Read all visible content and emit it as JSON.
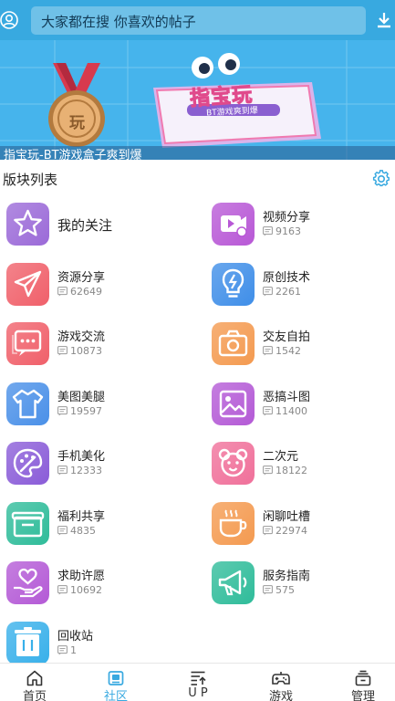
{
  "search": {
    "placeholder": "大家都在搜  你喜欢的帖子"
  },
  "banner": {
    "caption": "指宝玩-BT游戏盒子爽到爆",
    "logo_text": "指宝玩",
    "tagline": "BT游戏爽到爆",
    "medal_text": "玩"
  },
  "section": {
    "title": "版块列表"
  },
  "boards": [
    {
      "name": "我的关注",
      "count": "",
      "icon": "star-icon",
      "color": "#9b6ad8"
    },
    {
      "name": "视频分享",
      "count": "9163",
      "icon": "video-icon",
      "color": "#b858d6"
    },
    {
      "name": "资源分享",
      "count": "62649",
      "icon": "paper-plane-icon",
      "color": "#f0606a"
    },
    {
      "name": "原创技术",
      "count": "2261",
      "icon": "lightbulb-icon",
      "color": "#3f8ee8"
    },
    {
      "name": "游戏交流",
      "count": "10873",
      "icon": "chat-icon",
      "color": "#f0606a"
    },
    {
      "name": "交友自拍",
      "count": "1542",
      "icon": "camera-icon",
      "color": "#f49a50"
    },
    {
      "name": "美图美腿",
      "count": "19597",
      "icon": "tshirt-icon",
      "color": "#4a90e8"
    },
    {
      "name": "恶搞斗图",
      "count": "11400",
      "icon": "image-icon",
      "color": "#b45ad6"
    },
    {
      "name": "手机美化",
      "count": "12333",
      "icon": "palette-icon",
      "color": "#8a5cd8"
    },
    {
      "name": "二次元",
      "count": "18122",
      "icon": "bear-icon",
      "color": "#f0709a"
    },
    {
      "name": "福利共享",
      "count": "4835",
      "icon": "gift-icon",
      "color": "#2fbc9a"
    },
    {
      "name": "闲聊吐槽",
      "count": "22974",
      "icon": "coffee-icon",
      "color": "#f49a50"
    },
    {
      "name": "求助许愿",
      "count": "10692",
      "icon": "heart-hand-icon",
      "color": "#b45ad6"
    },
    {
      "name": "服务指南",
      "count": "575",
      "icon": "megaphone-icon",
      "color": "#2fbc9a"
    },
    {
      "name": "回收站",
      "count": "1",
      "icon": "trash-icon",
      "color": "#38b0ea"
    }
  ],
  "tabs": [
    {
      "label": "首页",
      "icon": "home-icon"
    },
    {
      "label": "社区",
      "icon": "community-icon",
      "active": true
    },
    {
      "label": "U P",
      "icon": "up-icon"
    },
    {
      "label": "游戏",
      "icon": "gamepad-icon"
    },
    {
      "label": "管理",
      "icon": "manage-icon"
    }
  ],
  "colors": {
    "primary": "#38a9e0",
    "banner_bg": "#46b4ec"
  }
}
